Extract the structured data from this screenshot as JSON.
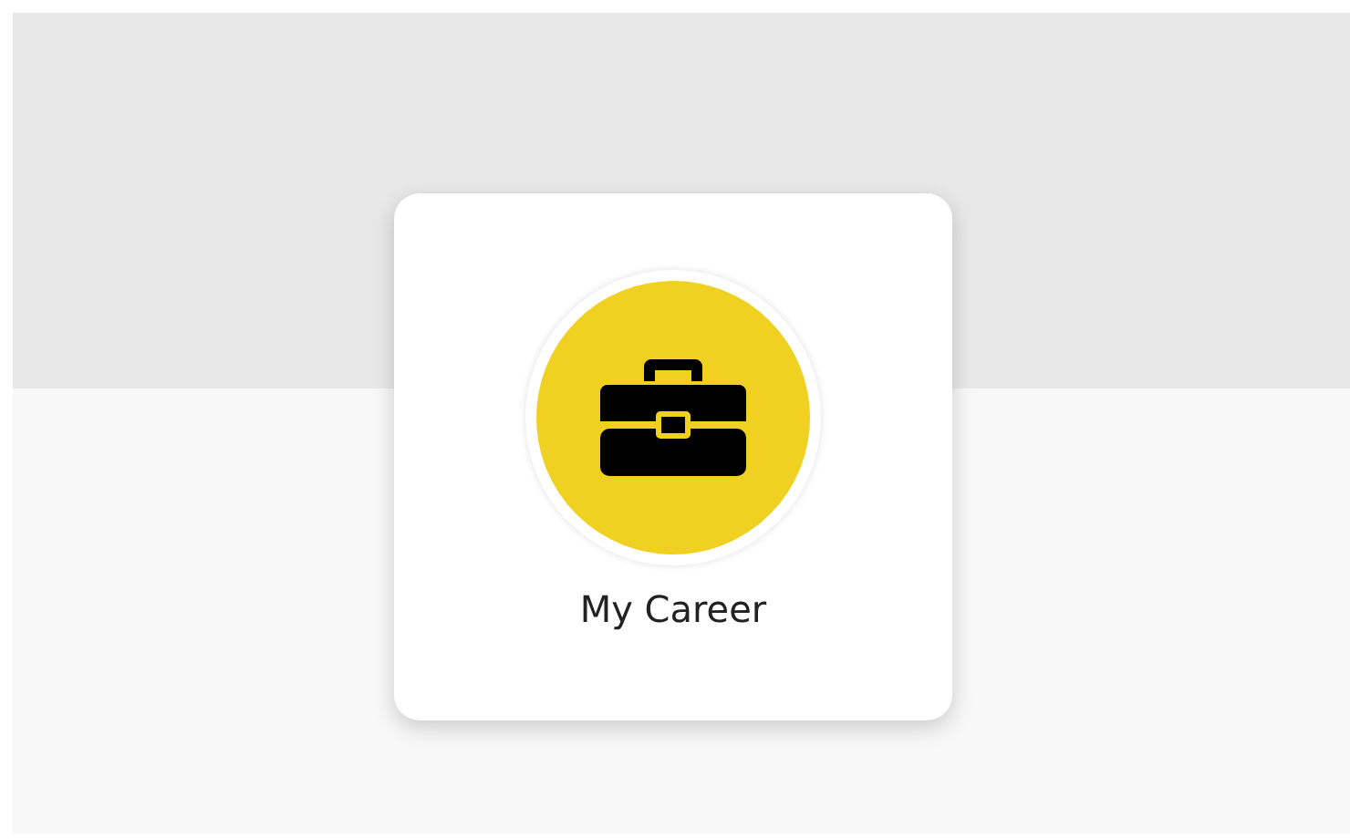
{
  "tile": {
    "label": "My Career"
  }
}
